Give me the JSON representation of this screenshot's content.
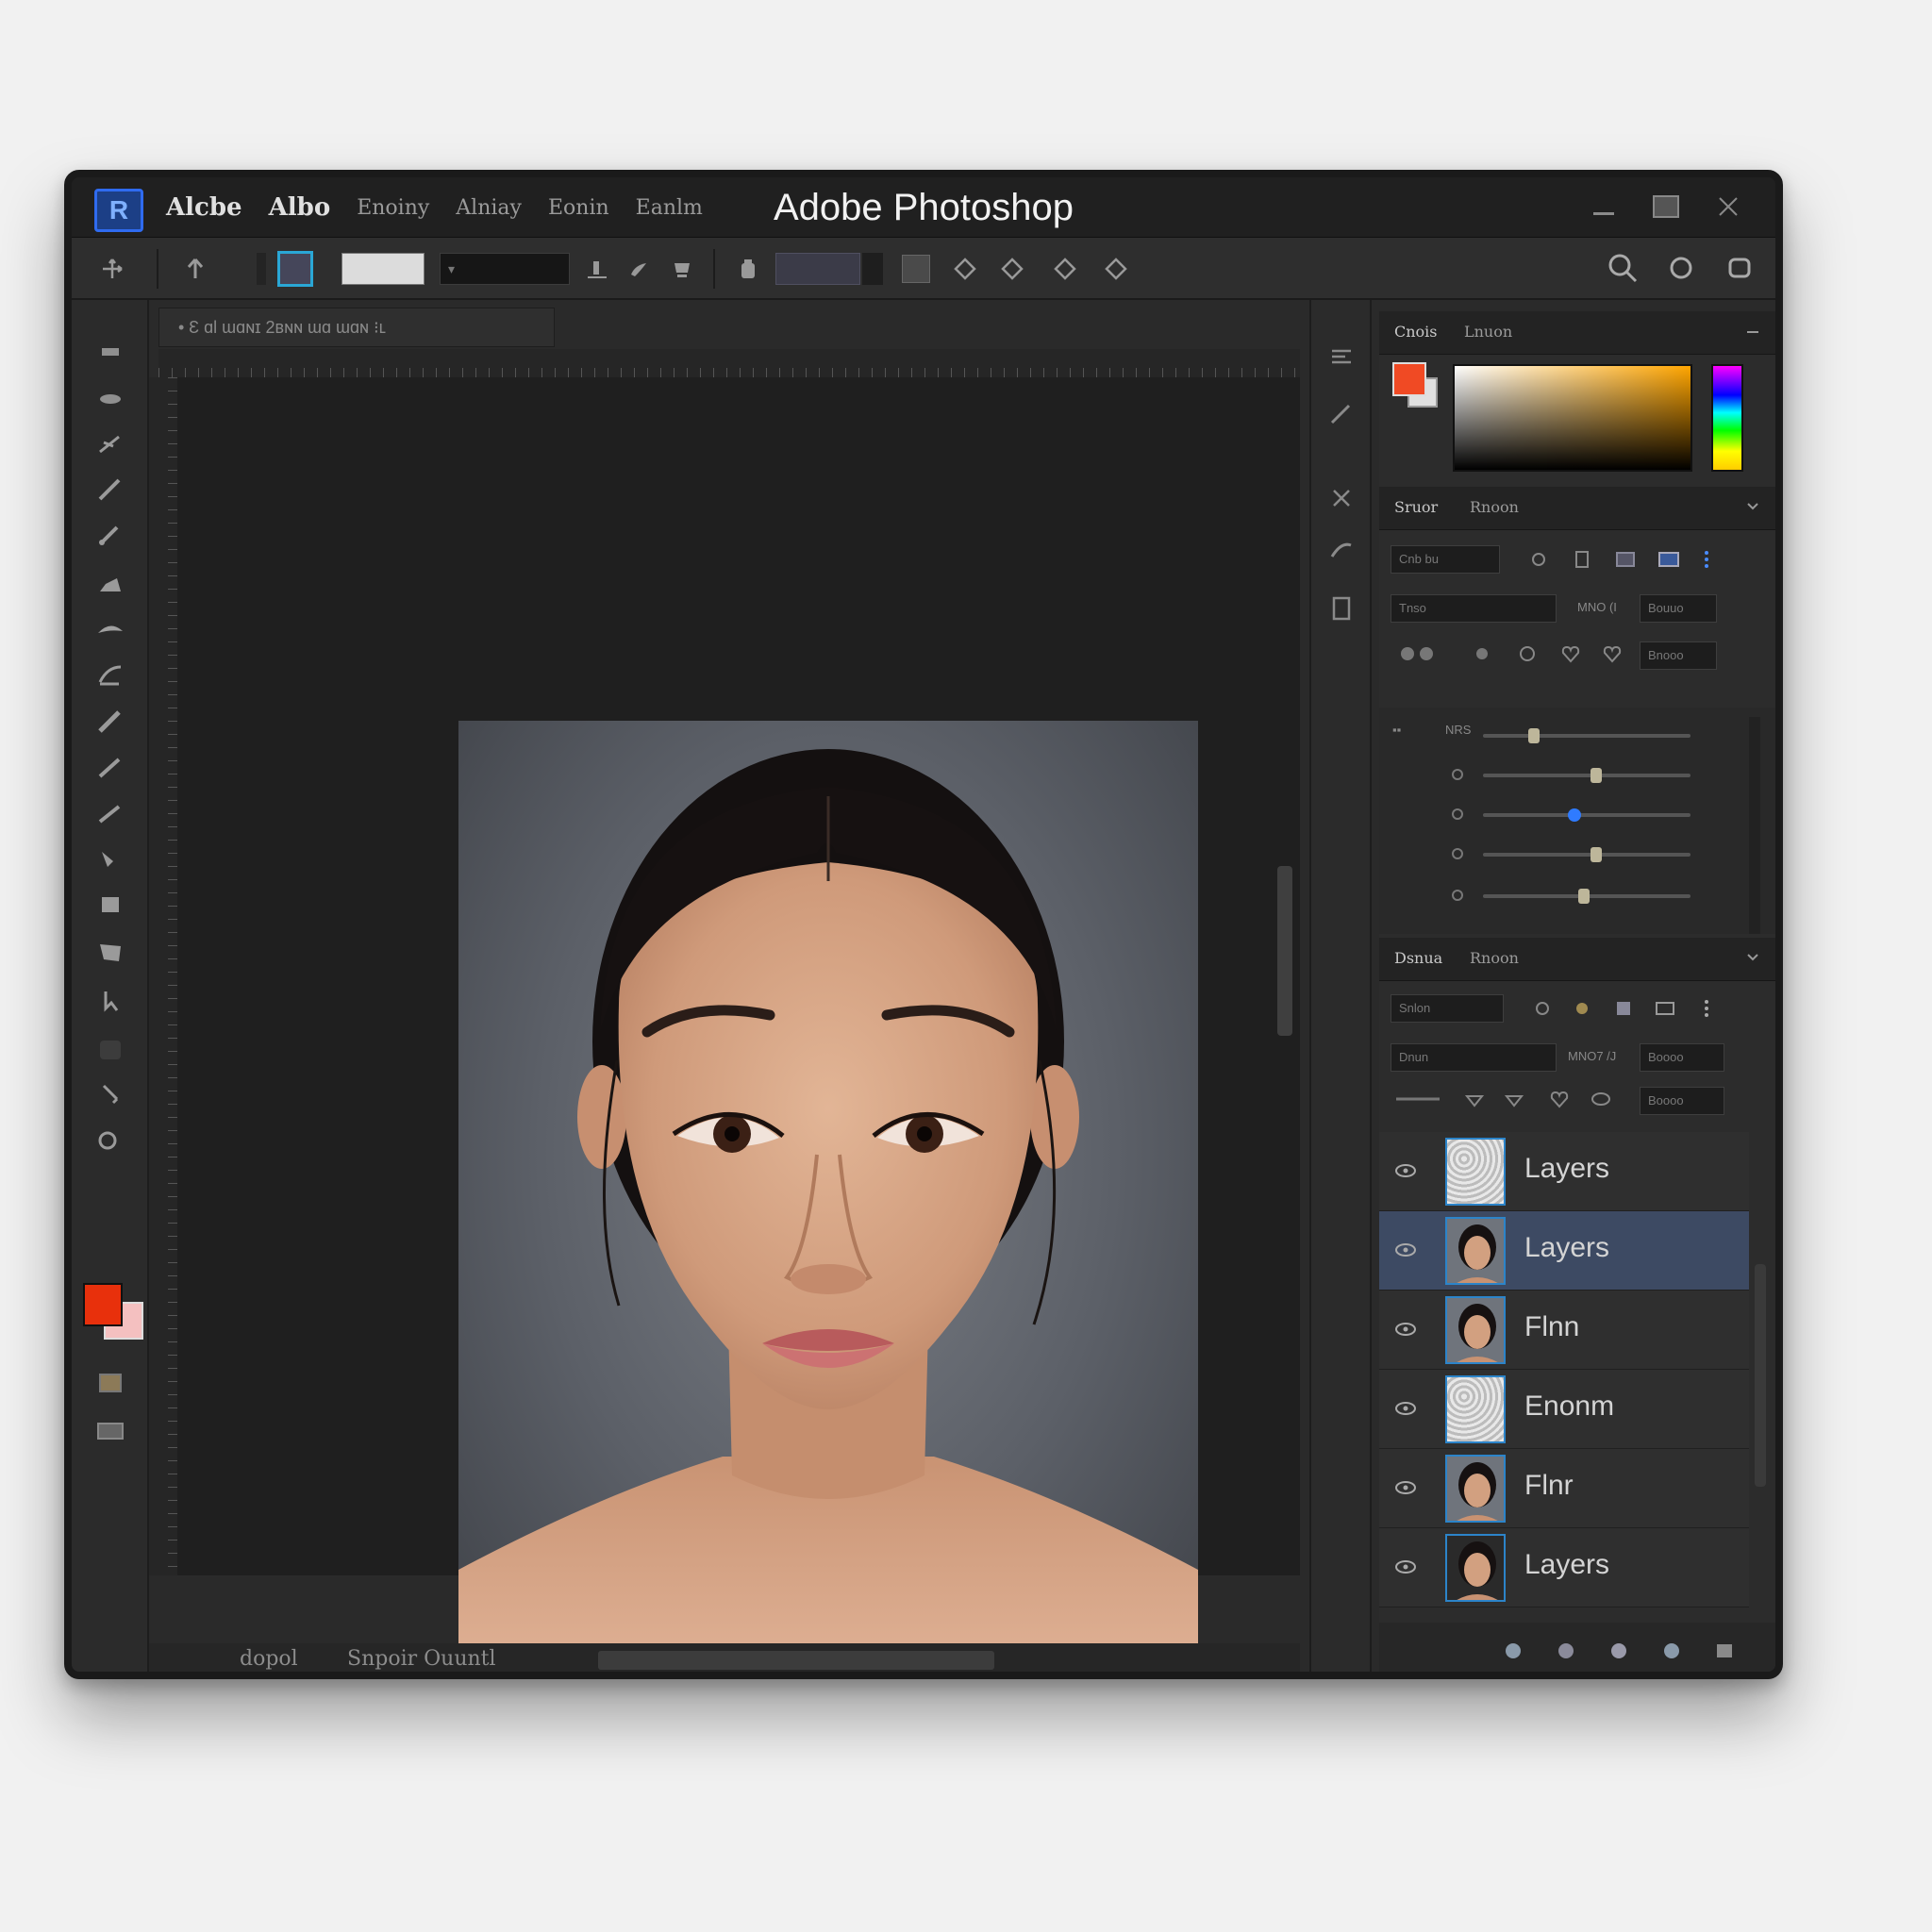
{
  "window": {
    "title": "Adobe Photoshop",
    "menu": [
      "Alcbe",
      "Albo",
      "Enoiny",
      "Alniay",
      "Eonin",
      "Eanlm"
    ],
    "controls": [
      "minimize",
      "maximize",
      "close"
    ]
  },
  "options_bar": {
    "dark_field_value": "▾",
    "icons": [
      "move-icon",
      "arrow-up-icon",
      "brush-icon",
      "stamp-icon",
      "search-icon",
      "circle-icon",
      "rounded-square-icon"
    ]
  },
  "document": {
    "tab_label": "• Ɛ  ɑl ɯɑɴɪ 2ʙɴɴ ɯɑ ɯɑɴ  ⁝ʟ",
    "status_left": "dopol",
    "status_mid": "Snpoir  Ouuntl"
  },
  "colors": {
    "foreground": "#e8300c",
    "background": "#f4c0c0",
    "selection": "#3d4a63",
    "accent": "#2aa7d6"
  },
  "color_panel": {
    "tabs": [
      "Cnois",
      "Lnuon"
    ]
  },
  "adjust_panel": {
    "tabs": [
      "Sruor",
      "Rnoon"
    ],
    "field1": "Cnb bu",
    "field2": "Tnso",
    "field3_label": "MNO (I",
    "field3": "Bouuo",
    "field4": "Bnooo",
    "slider_label": "NRS",
    "sliders": [
      0.22,
      0.52,
      0.41,
      0.52,
      0.46
    ]
  },
  "layers_panel": {
    "tabs": [
      "Dsnua",
      "Rnoon"
    ],
    "search": "Snlon",
    "blend_mode": "Dnun",
    "opacity_label": "MNO7 /J",
    "opacity_value": "Boooo",
    "fill_value": "Boooo",
    "layers": [
      {
        "name": "Layers",
        "thumb": "texture",
        "selected": false
      },
      {
        "name": "Layers",
        "thumb": "portrait",
        "selected": true
      },
      {
        "name": "Flnn",
        "thumb": "portrait",
        "selected": false
      },
      {
        "name": "Enonm",
        "thumb": "texture",
        "selected": false
      },
      {
        "name": "Flnr",
        "thumb": "portrait",
        "selected": false
      },
      {
        "name": "Layers",
        "thumb": "portrait-dark",
        "selected": false
      }
    ]
  }
}
